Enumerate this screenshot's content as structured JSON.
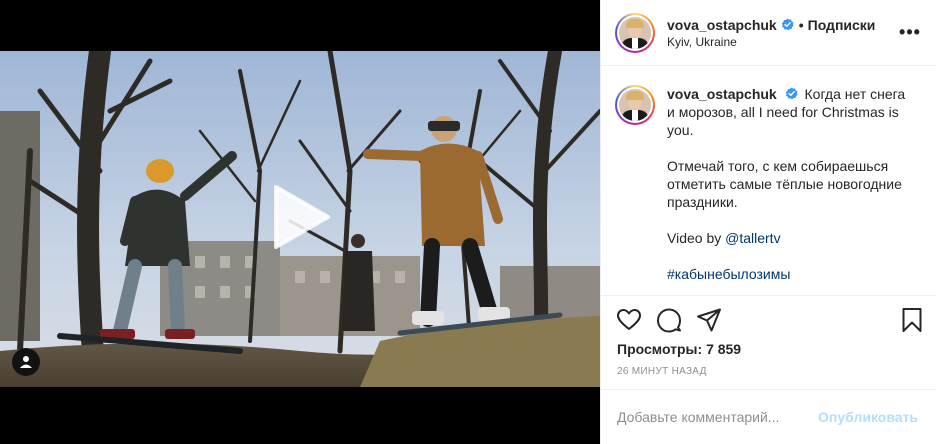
{
  "post": {
    "author": {
      "username": "vova_ostapchuk",
      "verified": true,
      "follow_label": "Подписки",
      "location": "Kyiv, Ukraine",
      "avatar_icon": "profile-avatar"
    },
    "caption": {
      "username": "vova_ostapchuk",
      "text_1": "Когда нет снега и морозов, all I need for Christmas is you.",
      "text_2": "Отмечай того, с кем собираешься отметить самые тёплые новогодние праздники.",
      "video_by_label": "Video by",
      "video_by_link": "@tallertv",
      "hashtag": "#кабынебылозимы"
    },
    "media": {
      "type": "video",
      "play_icon": "play-icon",
      "tag_icon": "user-tag-icon"
    },
    "actions": {
      "like_icon": "heart-icon",
      "comment_icon": "comment-icon",
      "share_icon": "share-icon",
      "save_icon": "bookmark-icon",
      "more_icon": "more-icon"
    },
    "views": {
      "label": "Просмотры:",
      "count": "7 859"
    },
    "timestamp": "26 МИНУТ НАЗАД",
    "comment": {
      "placeholder": "Добавьте комментарий...",
      "publish_label": "Опубликовать"
    },
    "colors": {
      "verified": "#3897f0",
      "link": "#00376b",
      "publish_disabled": "#b2dffc",
      "muted": "#8e8e8e"
    }
  }
}
